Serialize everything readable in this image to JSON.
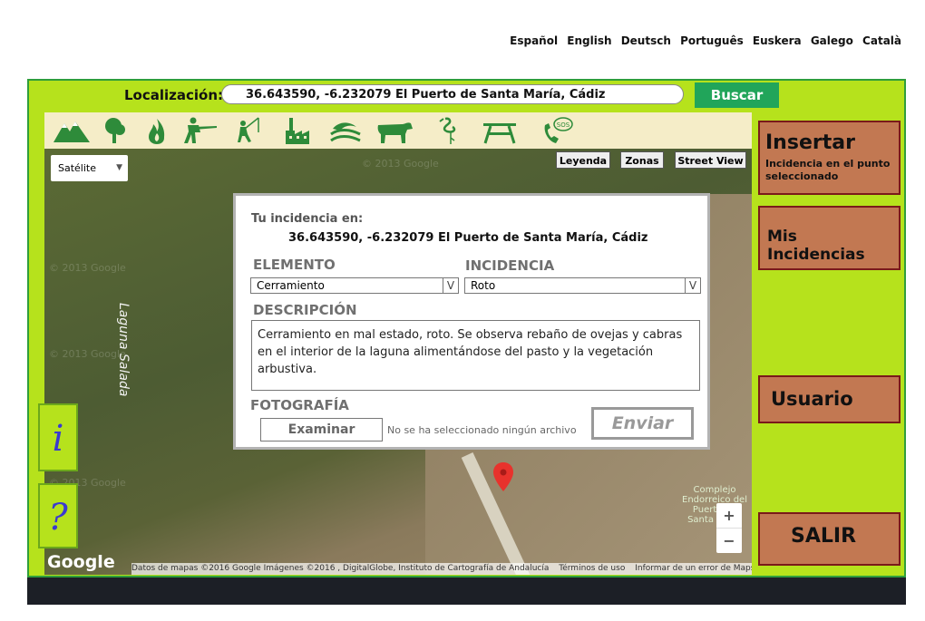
{
  "languages": [
    "Español",
    "English",
    "Deutsch",
    "Português",
    "Euskera",
    "Galego",
    "Català"
  ],
  "location": {
    "label": "Localización:",
    "value": "36.643590, -6.232079 El Puerto de Santa María, Cádiz",
    "search_button": "Buscar"
  },
  "category_icons": [
    "mountain-icon",
    "tree-icon",
    "fire-icon",
    "hunter-icon",
    "fisherman-icon",
    "factory-icon",
    "water-icon",
    "cattle-icon",
    "flamingo-icon",
    "picnic-table-icon",
    "emergency-phone-icon"
  ],
  "map": {
    "type_select": "Satélite",
    "buttons": [
      "Leyenda",
      "Zonas",
      "Street View"
    ],
    "place_label": "Laguna Salada",
    "watermark": "© 2013 Google",
    "protected_area_label": "Complejo Endorreico del Puerto de Santa María",
    "zoom_in": "+",
    "zoom_out": "−",
    "google_logo": "Google",
    "attribution": "Datos de mapas ©2016 Google Imágenes ©2016 , DigitalGlobe, Instituto de Cartografía de Andalucía",
    "terms": "Términos de uso",
    "report": "Informar de un error de Maps"
  },
  "left_buttons": {
    "info": "i",
    "help": "?"
  },
  "form": {
    "title": "Tu incidencia en:",
    "coords": "36.643590, -6.232079 El Puerto de Santa María, Cádiz",
    "element_label": "ELEMENTO",
    "element_value": "Cerramiento",
    "incident_label": "INCIDENCIA",
    "incident_value": "Roto",
    "dropdown_glyph": "V",
    "description_label": "DESCRIPCIÓN",
    "description_value": "Cerramiento en mal estado, roto. Se observa rebaño de ovejas y cabras en el interior de la laguna alimentándose del pasto y la vegetación arbustiva.",
    "photo_label": "FOTOGRAFÍA",
    "browse_button": "Examinar",
    "no_file": "No se ha seleccionado ningún archivo",
    "submit_button": "Enviar"
  },
  "right_menu": {
    "insert_title": "Insertar",
    "insert_sub": "Incidencia en el punto seleccionado",
    "my_incidents": "Mis Incidencias",
    "user": "Usuario",
    "exit": "SALIR"
  },
  "colors": {
    "green_bg": "#b6e21c",
    "brown_button": "#c27852",
    "search_green": "#21a55a"
  }
}
